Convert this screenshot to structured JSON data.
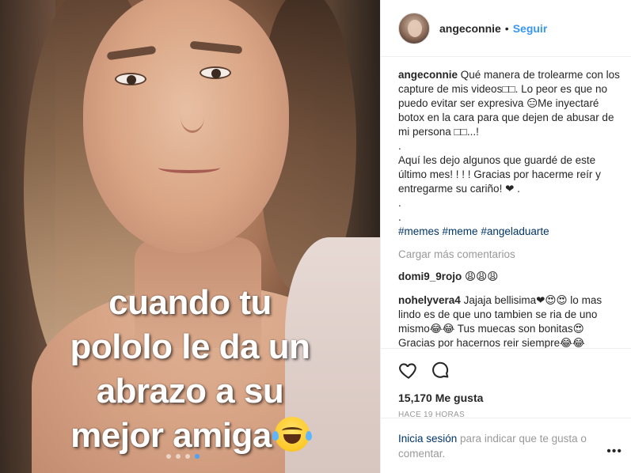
{
  "media": {
    "overlay_lines": [
      "cuando tu",
      "pololo le da un",
      "abrazo a su",
      "mejor amiga"
    ],
    "overlay_emoji": "tears-of-joy-emoji",
    "carousel": {
      "dots": 4,
      "active_index": 3
    }
  },
  "header": {
    "username": "angeconnie",
    "separator": "•",
    "follow_label": "Seguir"
  },
  "caption": {
    "username": "angeconnie",
    "text": "Qué manera de trolearme con los capture de mis videos□□. Lo peor es que no puedo evitar ser expresiva 😑Me inyectaré botox en la cara para que dejen de abusar de mi persona □□...!\n.\nAquí les dejo algunos que guardé de este último mes! ! ! ! Gracias por hacerme reír y entregarme su cariño! ❤ .\n.\n.",
    "hashtags": [
      "#memes",
      "#meme",
      "#angeladuarte"
    ]
  },
  "load_more": "Cargar más comentarios",
  "comments": [
    {
      "username": "domi9_9rojo",
      "text": "😩😩😩"
    },
    {
      "username": "nohelyvera4",
      "text": "Jajaja bellisima❤😍😍 lo mas lindo es de que uno tambien se ria de uno mismo😂😂 Tus muecas son bonitas😍 Gracias por hacernos reir siempre😂😂"
    }
  ],
  "actions": {
    "likes": "15,170 Me gusta",
    "time": "HACE 19 HORAS"
  },
  "footer": {
    "login_label": "Inicia sesión",
    "rest": " para indicar que te gusta o comentar.",
    "more": "•••"
  }
}
